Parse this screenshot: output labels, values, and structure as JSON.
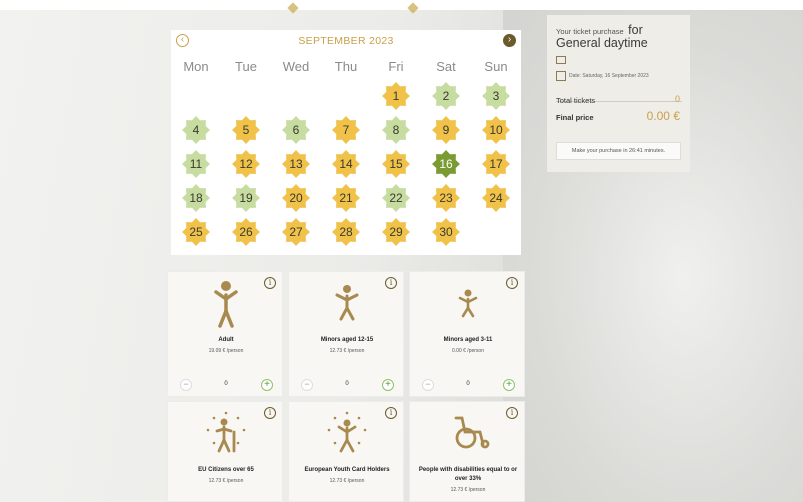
{
  "calendar": {
    "month_label": "SEPTEMBER 2023",
    "prev_icon": "chevron-left-icon",
    "next_icon": "chevron-right-icon",
    "weekdays": [
      "Mon",
      "Tue",
      "Wed",
      "Thu",
      "Fri",
      "Sat",
      "Sun"
    ],
    "colors": {
      "yellow": "#f0c24a",
      "light_green": "#c7dca0",
      "selected": "#7a9a32"
    },
    "days": [
      {
        "n": "1",
        "c": "yellow"
      },
      {
        "n": "2",
        "c": "light_green"
      },
      {
        "n": "3",
        "c": "light_green"
      },
      {
        "n": "4",
        "c": "light_green"
      },
      {
        "n": "5",
        "c": "yellow"
      },
      {
        "n": "6",
        "c": "light_green"
      },
      {
        "n": "7",
        "c": "yellow"
      },
      {
        "n": "8",
        "c": "light_green"
      },
      {
        "n": "9",
        "c": "yellow"
      },
      {
        "n": "10",
        "c": "yellow"
      },
      {
        "n": "11",
        "c": "light_green"
      },
      {
        "n": "12",
        "c": "yellow"
      },
      {
        "n": "13",
        "c": "yellow"
      },
      {
        "n": "14",
        "c": "yellow"
      },
      {
        "n": "15",
        "c": "yellow"
      },
      {
        "n": "16",
        "c": "selected"
      },
      {
        "n": "17",
        "c": "yellow"
      },
      {
        "n": "18",
        "c": "light_green"
      },
      {
        "n": "19",
        "c": "light_green"
      },
      {
        "n": "20",
        "c": "yellow"
      },
      {
        "n": "21",
        "c": "yellow"
      },
      {
        "n": "22",
        "c": "light_green"
      },
      {
        "n": "23",
        "c": "yellow"
      },
      {
        "n": "24",
        "c": "yellow"
      },
      {
        "n": "25",
        "c": "yellow"
      },
      {
        "n": "26",
        "c": "yellow"
      },
      {
        "n": "27",
        "c": "yellow"
      },
      {
        "n": "28",
        "c": "yellow"
      },
      {
        "n": "29",
        "c": "yellow"
      },
      {
        "n": "30",
        "c": "yellow"
      }
    ]
  },
  "summary": {
    "title_small": "Your ticket purchase",
    "title_for": "for",
    "title_large": "General daytime",
    "date_label": "Date: Saturday, 16 September 2023",
    "total_tickets_label": "Total tickets",
    "total_tickets_value": "0",
    "final_price_label": "Final price",
    "final_price_value": "0.00 €",
    "timer_text": "Make your purchase in 26:41 minutes."
  },
  "tickets": [
    {
      "name": "Adult",
      "price": "19.09 € /person",
      "qty": "0",
      "icon": "adult-person-icon"
    },
    {
      "name": "Minors aged 12-15",
      "price": "12.73 € /person",
      "qty": "0",
      "icon": "minor-person-icon"
    },
    {
      "name": "Minors aged 3-11",
      "price": "0.00 € /person",
      "qty": "0",
      "icon": "child-person-icon"
    },
    {
      "name": "EU Citizens over 65",
      "price": "12.73 € /person",
      "icon": "senior-eu-icon"
    },
    {
      "name": "European Youth Card Holders",
      "price": "12.73 € /person",
      "icon": "youth-card-icon"
    },
    {
      "name": "People with disabilities equal to or over 33%",
      "price": "12.73 € /person",
      "icon": "wheelchair-icon"
    }
  ],
  "ui": {
    "minus": "−",
    "plus": "+",
    "info": "i",
    "prev": "‹",
    "next": "›"
  }
}
